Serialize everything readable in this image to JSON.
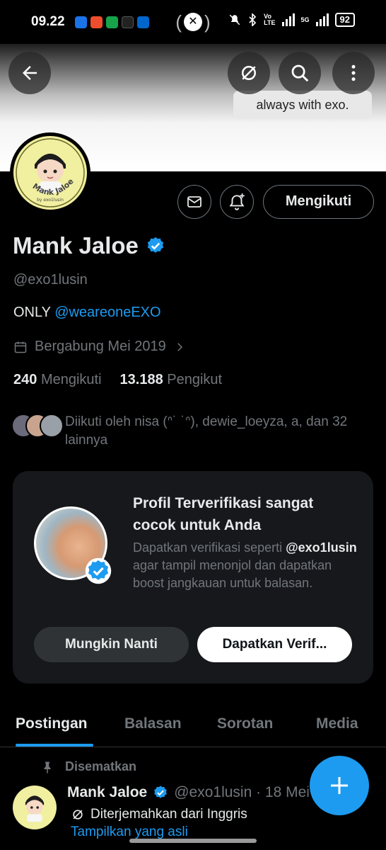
{
  "status_bar": {
    "time": "09.22",
    "network_label_top": "Vo",
    "network_label_bottom": "LTE",
    "network_5g": "5G",
    "battery": "92",
    "app_colors": [
      "#1a73e8",
      "#ee4d2d",
      "#16a34a",
      "#111111",
      "#0066cc"
    ]
  },
  "banner": {
    "bubble_text": "always with exo."
  },
  "profile": {
    "follow_button": "Mengikuti",
    "name": "Mank Jaloe",
    "handle": "@exo1lusin",
    "bio_prefix": "ONLY ",
    "bio_link": "@weareoneEXO",
    "joined": "Bergabung Mei 2019",
    "following_count": "240",
    "following_label": "Mengikuti",
    "followers_count": "13.188",
    "followers_label": "Pengikut",
    "followed_by": "Diikuti oleh nisa (ᐢ˙ ˙ᐢ), dewie_loeyza, a, dan 32 lainnya",
    "avatar_text": "Mank Jaloe",
    "avatar_subtext": "by exo1lusin"
  },
  "verify_card": {
    "title": "Profil Terverifikasi sangat cocok untuk Anda",
    "desc_before": "Dapatkan verifikasi seperti ",
    "desc_handle": "@exo1lusin",
    "desc_after": " agar tampil menonjol dan dapatkan boost jangkauan untuk balasan.",
    "later_button": "Mungkin Nanti",
    "get_button": "Dapatkan Verif..."
  },
  "tabs": [
    "Postingan",
    "Balasan",
    "Sorotan",
    "Media"
  ],
  "pinned_post": {
    "pinned_label": "Disematkan",
    "author": "Mank Jaloe",
    "meta": "@exo1lusin · 18 Mei",
    "translated": "Diterjemahkan dari Inggris",
    "show_original": "Tampilkan yang asli"
  },
  "colors": {
    "accent": "#1d9bf0",
    "background": "#000000",
    "muted_text": "#71767b",
    "card": "#16181c"
  },
  "icons": [
    "back-arrow-icon",
    "translate-off-icon",
    "search-icon",
    "more-vertical-icon",
    "mail-icon",
    "bell-plus-icon",
    "verified-badge-icon",
    "calendar-icon",
    "chevron-right-icon",
    "pin-icon",
    "plus-icon"
  ]
}
